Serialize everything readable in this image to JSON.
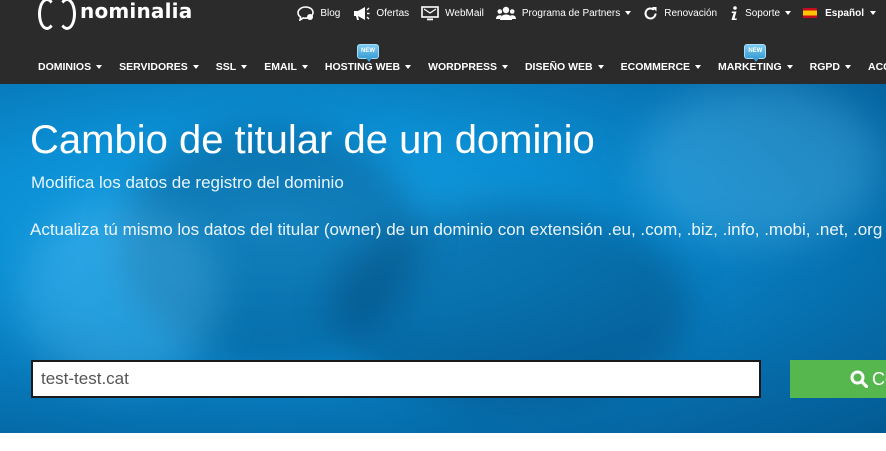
{
  "brand": {
    "name": "nominalia"
  },
  "toplinks": [
    {
      "label": "Blog",
      "icon": "chat-bubble-icon"
    },
    {
      "label": "Ofertas",
      "icon": "megaphone-icon"
    },
    {
      "label": "WebMail",
      "icon": "monitor-icon"
    },
    {
      "label": "Programa de Partners",
      "icon": "users-icon"
    },
    {
      "label": "Renovación",
      "icon": "refresh-icon"
    },
    {
      "label": "Soporte",
      "icon": "info-icon"
    }
  ],
  "language": {
    "label": "Español"
  },
  "nav": [
    {
      "label": "DOMINIOS",
      "badge": ""
    },
    {
      "label": "SERVIDORES",
      "badge": ""
    },
    {
      "label": "SSL",
      "badge": ""
    },
    {
      "label": "EMAIL",
      "badge": ""
    },
    {
      "label": "HOSTING WEB",
      "badge": "NEW"
    },
    {
      "label": "WORDPRESS",
      "badge": ""
    },
    {
      "label": "DISEÑO WEB",
      "badge": ""
    },
    {
      "label": "ECOMMERCE",
      "badge": ""
    },
    {
      "label": "MARKETING",
      "badge": "NEW"
    },
    {
      "label": "RGPD",
      "badge": ""
    },
    {
      "label": "ACCES",
      "badge": ""
    }
  ],
  "hero": {
    "title": "Cambio de titular de un dominio",
    "subtitle": "Modifica los datos de registro del dominio",
    "description": "Actualiza tú mismo los datos del titular (owner) de un dominio con extensión .eu, .com, .biz, .info, .mobi, .net, .org"
  },
  "search": {
    "value": "test-test.cat",
    "button_label": "Comprobar"
  },
  "colors": {
    "topbar": "#2b2b2b",
    "hero": "#0b8ed3",
    "button": "#57b74f"
  }
}
